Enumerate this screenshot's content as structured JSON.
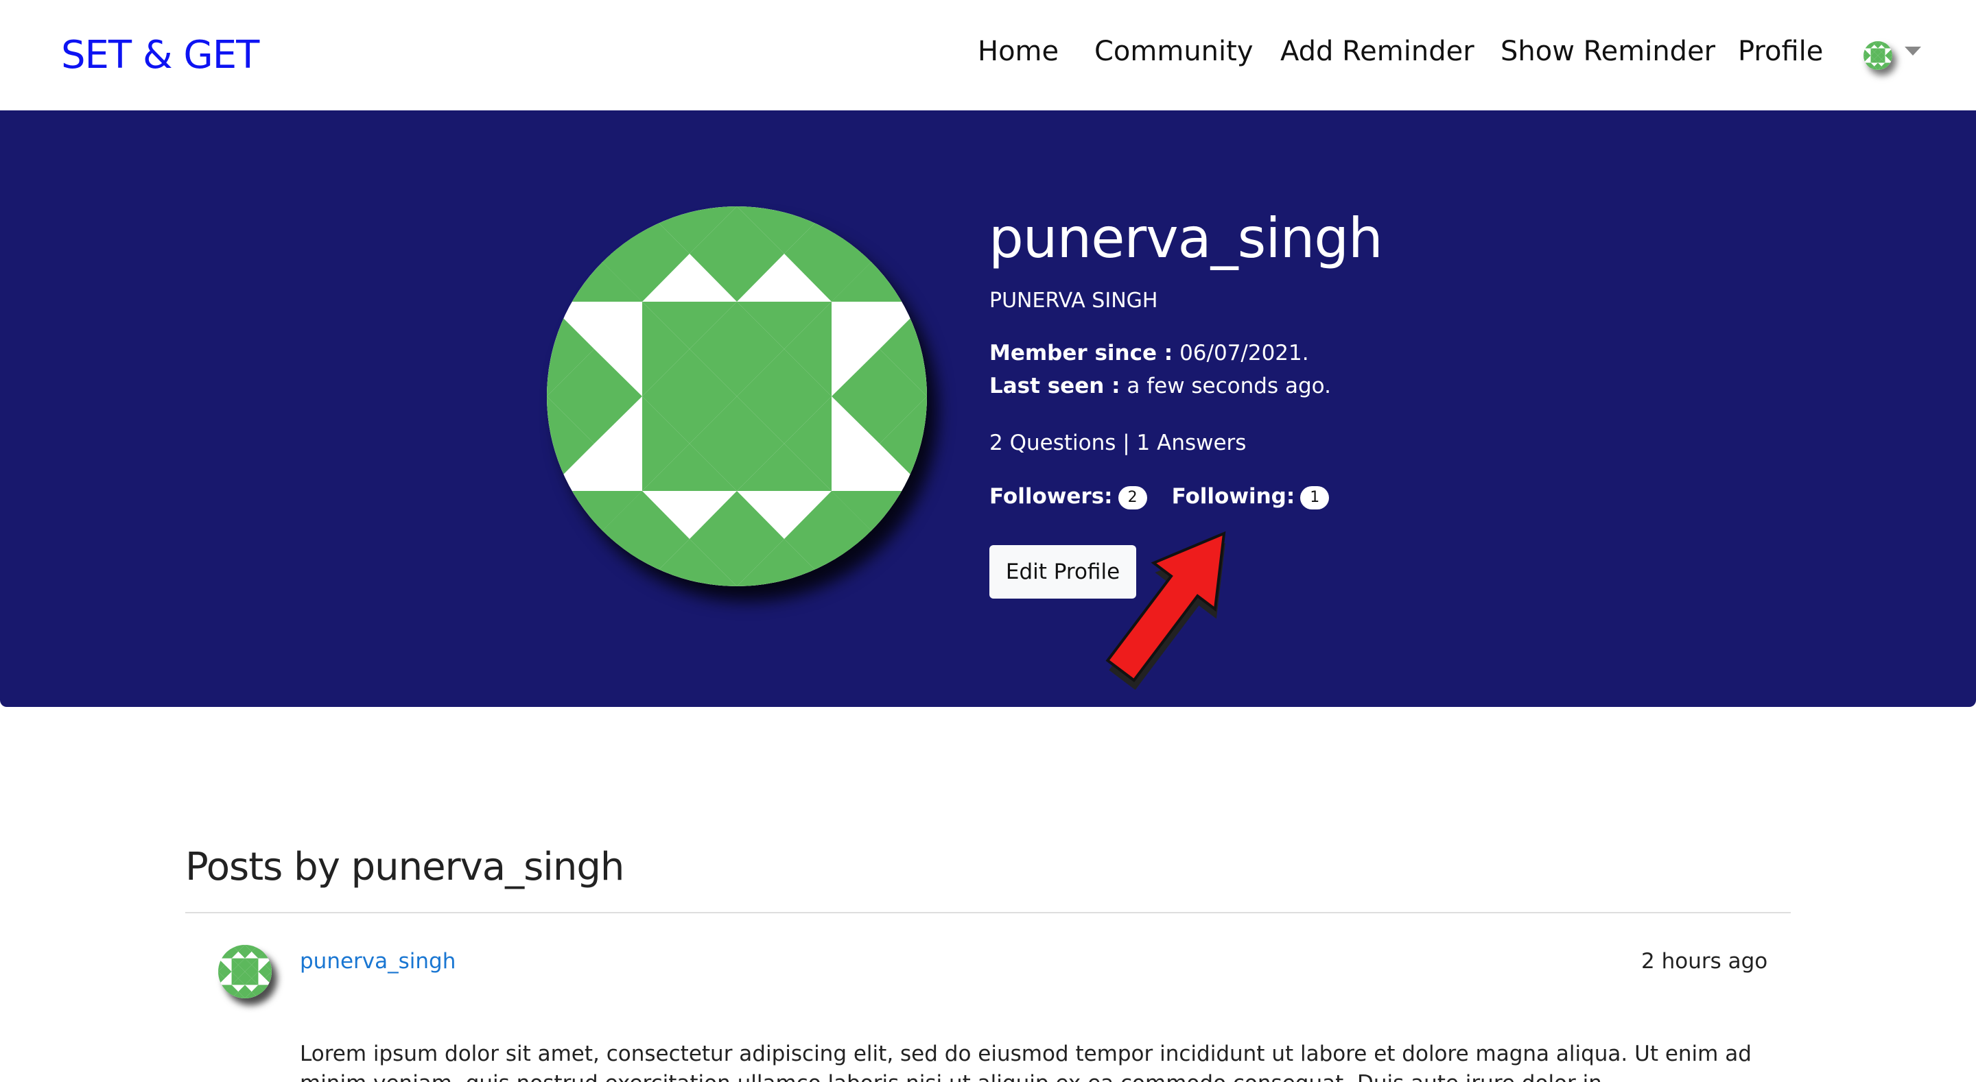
{
  "navbar": {
    "brand": "SET & GET",
    "links": [
      "Home",
      "Community",
      "Add Reminder",
      "Show Reminder",
      "Profile"
    ]
  },
  "profile": {
    "username": "punerva_singh",
    "full_name": "PUNERVA SINGH",
    "member_since_label": "Member since :",
    "member_since_value": "06/07/2021.",
    "last_seen_label": "Last seen :",
    "last_seen_value": "a few seconds ago.",
    "stats": "2 Questions | 1 Answers",
    "followers_label": "Followers:",
    "followers_count": "2",
    "following_label": "Following:",
    "following_count": "1",
    "edit_button": "Edit Profile"
  },
  "posts": {
    "title": "Posts by punerva_singh",
    "items": [
      {
        "author": "punerva_singh",
        "time": "2 hours ago",
        "body": "Lorem ipsum dolor sit amet, consectetur adipiscing elit, sed do eiusmod tempor incididunt ut labore et dolore magna aliqua. Ut enim ad minim veniam, quis nostrud exercitation ullamco laboris nisi ut aliquip ex ea commodo consequat. Duis aute irure dolor in reprehenderit in voluptate velit"
      }
    ]
  },
  "colors": {
    "brand": "#0d13f2",
    "hero_background": "#18186d",
    "avatar_green": "#5cb85c",
    "link_blue": "#1976d2",
    "annotation_arrow": "#ee1c1c"
  },
  "icons": {
    "avatar": "identicon-avatar-icon",
    "caret": "caret-down-icon",
    "annotation": "red-arrow-icon"
  }
}
